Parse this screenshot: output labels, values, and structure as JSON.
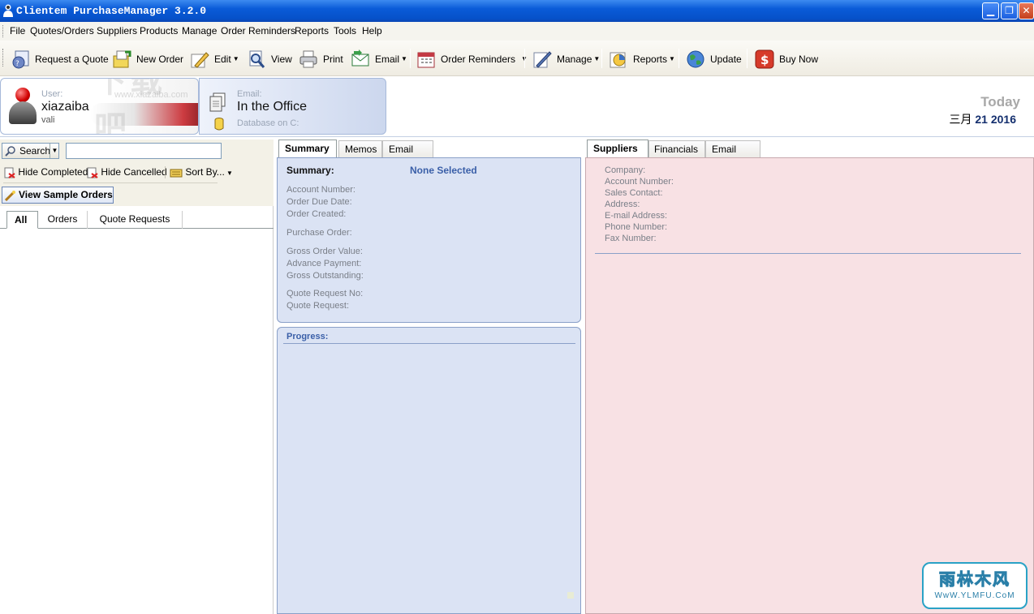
{
  "window": {
    "title": "Clientem PurchaseManager 3.2.0"
  },
  "menu": [
    "File",
    "Quotes/Orders",
    "Suppliers",
    "Products",
    "Manage",
    "Order Reminders",
    "Reports",
    "Tools",
    "Help"
  ],
  "toolbar": {
    "request_quote": "Request a Quote",
    "new_order": "New Order",
    "edit": "Edit",
    "view": "View",
    "print": "Print",
    "email": "Email",
    "order_reminders": "Order Reminders",
    "manage": "Manage",
    "reports": "Reports",
    "update": "Update",
    "buy_now": "Buy Now"
  },
  "user": {
    "label": "User:",
    "name": "xiazaiba",
    "sub": "vali"
  },
  "status": {
    "label": "Email:",
    "value": "In the Office",
    "database": "Database on C:"
  },
  "today": {
    "label": "Today",
    "month": "三月",
    "date": "21 2016"
  },
  "left": {
    "search_label": "Search",
    "search_value": "",
    "hide_completed": "Hide Completed",
    "hide_cancelled": "Hide Cancelled",
    "sort_by": "Sort By...",
    "view_sample_orders": "View Sample Orders",
    "tabs": [
      "All",
      "Orders",
      "Quote Requests"
    ]
  },
  "middle": {
    "tabs": [
      "Summary",
      "Memos",
      "Email Log"
    ],
    "summary_label": "Summary:",
    "summary_value": "None Selected",
    "fields": {
      "account_number": "Account Number:",
      "order_due_date": "Order Due Date:",
      "order_created": "Order Created:",
      "purchase_order": "Purchase Order:",
      "gross_order_value": "Gross Order Value:",
      "advance_payment": "Advance Payment:",
      "gross_outstanding": "Gross Outstanding:",
      "quote_request_no": "Quote Request No:",
      "quote_request": "Quote Request:"
    },
    "progress_label": "Progress:"
  },
  "right": {
    "tabs": [
      "Suppliers",
      "Financials",
      "Email Logs"
    ],
    "fields": [
      "Company:",
      "Account Number:",
      "Sales Contact:",
      "Address:",
      "E-mail Address:",
      "Phone Number:",
      "Fax Number:"
    ]
  },
  "watermark": {
    "title": "雨林木风",
    "url": "WwW.YLMFU.CoM",
    "ghost": "下载吧",
    "ghost_url": "www.xiazaiba.com"
  },
  "colors": {
    "titlebar": "#0a5bd8",
    "summary_bg": "#dbe3f4",
    "supplier_bg": "#f8e1e4",
    "accent_blue": "#3a5fa8"
  }
}
